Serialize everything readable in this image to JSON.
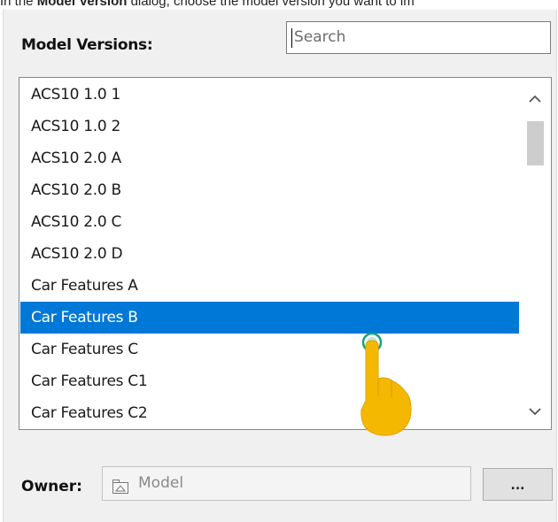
{
  "doc": {
    "pre": "In the ",
    "bold": "Model Version",
    "post": " dialog, choose the model version you want to im"
  },
  "dialog": {
    "model_versions_label": "Model Versions:",
    "search": {
      "placeholder": "Search",
      "value": ""
    },
    "list": {
      "items": [
        "ACS10 1.0 1",
        "ACS10 1.0 2",
        "ACS10 2.0 A",
        "ACS10 2.0 B",
        "ACS10 2.0 C",
        "ACS10 2.0 D",
        "Car Features A",
        "Car Features B",
        "Car Features C",
        "Car Features C1",
        "Car Features C2"
      ],
      "selected_index": 7
    },
    "scrollbar": {
      "up_icon": "chevron-up-icon",
      "down_icon": "chevron-down-icon"
    },
    "owner": {
      "label": "Owner:",
      "value": "Model",
      "icon": "package-icon"
    },
    "browse_button_label": "..."
  },
  "colors": {
    "selection": "#0078d7",
    "cursor_hand": "#f5b800",
    "cursor_click_ring": "#1aa37a"
  }
}
